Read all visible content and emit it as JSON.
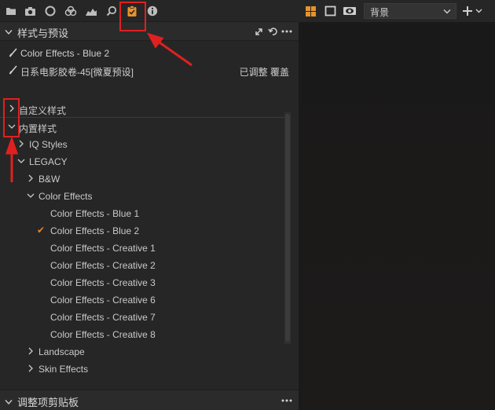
{
  "toolbar": {
    "icons": [
      "folder-icon",
      "camera-icon",
      "circle-icon",
      "color-icon",
      "chart-icon",
      "search-icon",
      "styles-icon",
      "info-icon"
    ],
    "active": "styles-icon",
    "accent": "#e8932a"
  },
  "styles_panel": {
    "title": "样式与预设"
  },
  "applied": [
    {
      "label": "Color Effects - Blue 2",
      "status": ""
    },
    {
      "label": "日系电影胶卷-45[微夏预设]",
      "status": "已调整 覆盖"
    }
  ],
  "tree": {
    "custom_styles": "自定义样式",
    "builtin_styles": "内置样式",
    "iq_styles": "IQ Styles",
    "legacy": "LEGACY",
    "bw": "B&W",
    "color_effects": "Color Effects",
    "items": [
      "Color Effects - Blue 1",
      "Color Effects - Blue 2",
      "Color Effects - Creative 1",
      "Color Effects - Creative 2",
      "Color Effects - Creative 3",
      "Color Effects - Creative 6",
      "Color Effects - Creative 7",
      "Color Effects - Creative 8"
    ],
    "checked_item": "Color Effects - Blue 2",
    "landscape": "Landscape",
    "skin_effects": "Skin Effects"
  },
  "clipboard_panel": {
    "title": "调整项剪贴板"
  },
  "viewer": {
    "background_select": "背景"
  },
  "colors": {
    "annotation_red": "#e02020",
    "check_orange": "#e8832a"
  }
}
